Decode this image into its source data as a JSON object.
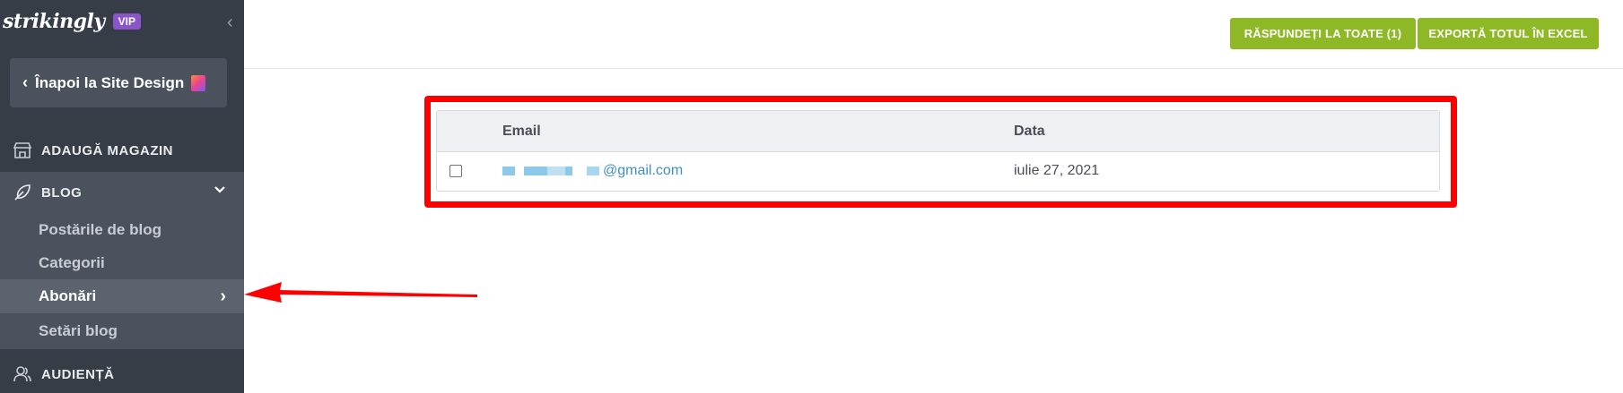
{
  "brand": {
    "logo": "strikingly",
    "badge": "VIP"
  },
  "sidebar": {
    "back_label": "Înapoi la Site Design",
    "shop_label": "ADAUGĂ MAGAZIN",
    "blog_label": "BLOG",
    "blog_subitems": [
      {
        "label": "Postările de blog"
      },
      {
        "label": "Categorii"
      },
      {
        "label": "Abonări",
        "active": true
      },
      {
        "label": "Setări blog"
      }
    ],
    "audience_label": "AUDIENȚĂ"
  },
  "toolbar": {
    "reply_all_label": "RĂSPUNDEȚI LA TOATE (1)",
    "export_label": "EXPORTĂ TOTUL ÎN EXCEL"
  },
  "table": {
    "columns": [
      "Email",
      "Data"
    ],
    "rows": [
      {
        "email_suffix": "@gmail.com",
        "date": "iulie 27, 2021",
        "checked": false
      }
    ]
  },
  "colors": {
    "sidebar_bg": "#373d47",
    "sidebar_active_bg": "#4b525d",
    "accent_green": "#8fb827",
    "vip_purple": "#8a55c9",
    "link_blue": "#3f8fc5",
    "highlight_red": "#ff0000"
  },
  "icons": {
    "collapse": "chevron-left-icon",
    "shop": "store-icon",
    "blog": "feather-icon",
    "audience": "people-icon"
  }
}
